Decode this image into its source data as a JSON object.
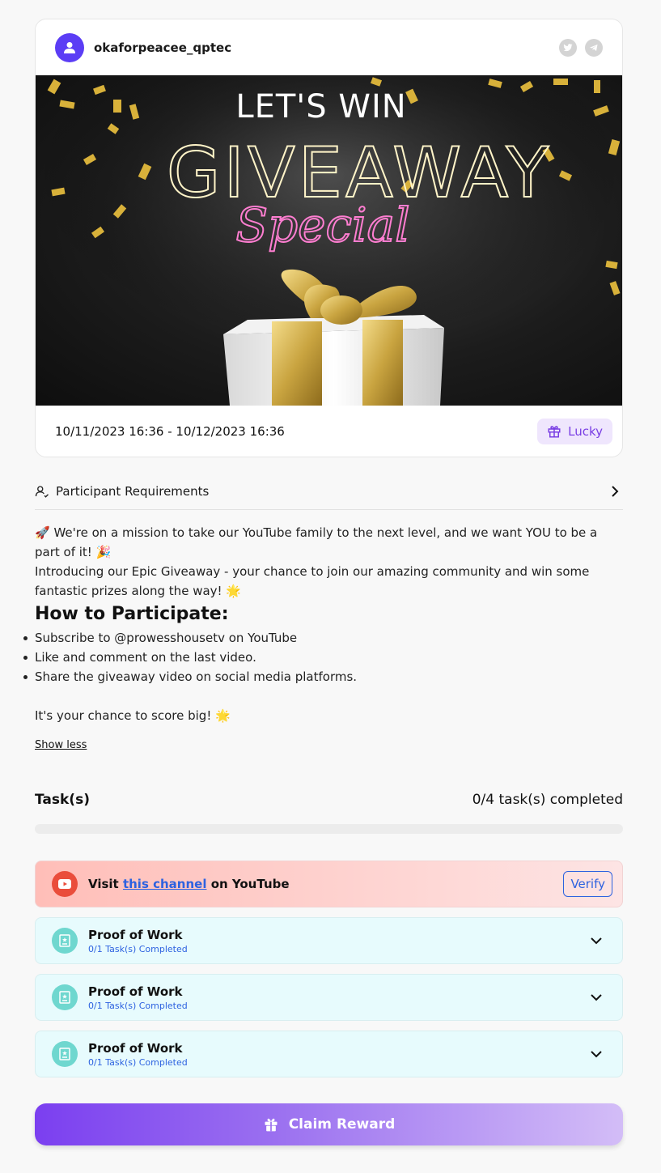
{
  "user": {
    "username": "okaforpeacee_qptec"
  },
  "social_icons": [
    "twitter-icon",
    "telegram-icon"
  ],
  "banner": {
    "line1": "LET'S WIN",
    "line2": "GIVEAWAY",
    "line3": "Special"
  },
  "event": {
    "date_range": "10/11/2023 16:36 - 10/12/2023 16:36",
    "badge": "Lucky"
  },
  "requirements": {
    "label": "Participant Requirements"
  },
  "description": {
    "line1": "🚀 We're on a mission to take our YouTube family to the next level, and we want YOU to be a part of it! 🎉",
    "line2": "Introducing our Epic Giveaway - your chance to join our amazing community and win some fantastic prizes along the way! 🌟",
    "heading": "How to Participate:",
    "steps": [
      "Subscribe to @prowesshousetv on YouTube",
      "Like and comment on the last video.",
      "Share the giveaway video on social media platforms."
    ],
    "closing": "It's your chance to score big! 🌟",
    "toggle": "Show less"
  },
  "tasks": {
    "title": "Task(s)",
    "count_label": "0/4 task(s) completed",
    "progress_fraction": 0,
    "youtube": {
      "prefix": "Visit ",
      "link": "this channel",
      "suffix": " on YouTube",
      "verify_label": "Verify"
    },
    "items": [
      {
        "title": "Proof of Work",
        "sub": "0/1 Task(s) Completed"
      },
      {
        "title": "Proof of Work",
        "sub": "0/1 Task(s) Completed"
      },
      {
        "title": "Proof of Work",
        "sub": "0/1 Task(s) Completed"
      }
    ]
  },
  "claim": {
    "label": "Claim Reward"
  },
  "colors": {
    "accent": "#7a3fe4",
    "link": "#2d62e0",
    "youtube": "#ea4d3b",
    "proof": "#6fd7cf",
    "avatar": "#5b3df5"
  }
}
